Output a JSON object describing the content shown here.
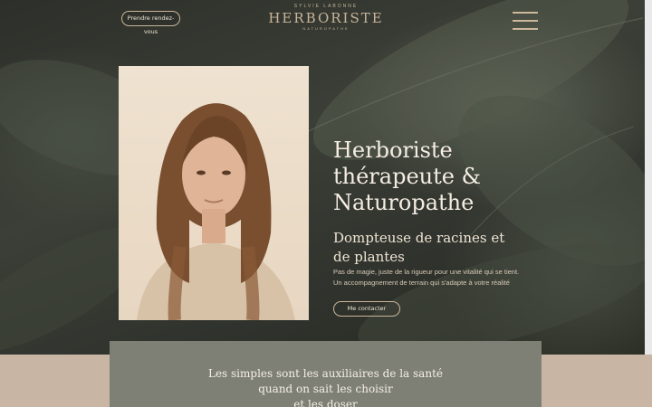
{
  "header": {
    "rdv_label": "Prendre rendez-vous",
    "logo_top": "SYLVIE LABONNE",
    "logo_main": "HERBORISTE",
    "logo_bottom": "NATUROPATHE",
    "menu_icon": "hamburger-menu-icon"
  },
  "hero": {
    "headline": [
      "Herboriste",
      "thérapeute &",
      "Naturopathe"
    ],
    "subhead": [
      "Dompteuse de racines et",
      "de plantes"
    ],
    "description": [
      "Pas de magie, juste de la rigueur pour une vitalité qui se tient.",
      "Un accompagnement de terrain qui s'adapte à votre réalité"
    ],
    "contact_label": "Me contacter"
  },
  "quote": {
    "lines": [
      "Les simples sont les auxiliaires de la santé",
      "quand on sait les choisir",
      "et les doser"
    ]
  },
  "colors": {
    "accent": "#c9b59a",
    "hero_bg": "#33362f",
    "quote_bg": "#7e8075",
    "footer_bg": "#c9b5a3"
  }
}
